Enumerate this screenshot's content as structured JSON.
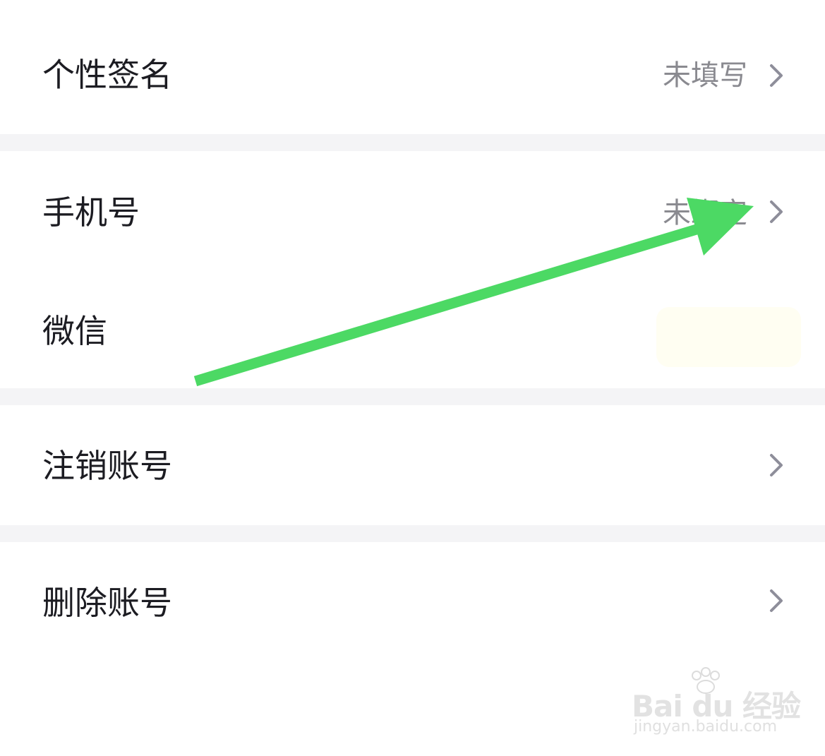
{
  "settings": {
    "signature": {
      "label": "个性签名",
      "value": "未填写"
    },
    "phone": {
      "label": "手机号",
      "value": "未绑定"
    },
    "wechat": {
      "label": "微信"
    },
    "deactivate": {
      "label": "注销账号"
    },
    "delete": {
      "label": "删除账号"
    }
  },
  "annotation": {
    "arrow_color": "#4cd964"
  },
  "watermark": {
    "brand": "Bai du 经验",
    "url": "jingyan.baidu.com"
  },
  "colors": {
    "separator": "#f4f4f6",
    "label_text": "#1c1c22",
    "value_text": "#8a8a90",
    "chevron": "#8e8e9a"
  }
}
